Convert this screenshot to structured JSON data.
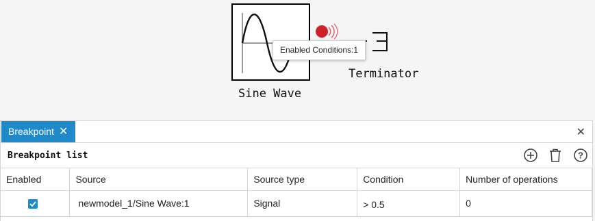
{
  "canvas": {
    "sine_block_label": "Sine Wave",
    "terminator_label": "Terminator",
    "tooltip_text": "Enabled Conditions:1",
    "breakpoint_marker_color": "#d0202a"
  },
  "panel": {
    "tab_label": "Breakpoint",
    "list_title": "Breakpoint list",
    "toolbar_icons": [
      "add-circle-icon",
      "trash-icon",
      "help-icon"
    ],
    "columns": [
      "Enabled",
      "Source",
      "Source type",
      "Condition",
      "Number of operations"
    ],
    "rows": [
      {
        "enabled": true,
        "source": "newmodel_1/Sine Wave:1",
        "source_type": "Signal",
        "condition": "> 0.5",
        "operations": "0"
      }
    ]
  },
  "colors": {
    "accent": "#1f8ac9"
  }
}
